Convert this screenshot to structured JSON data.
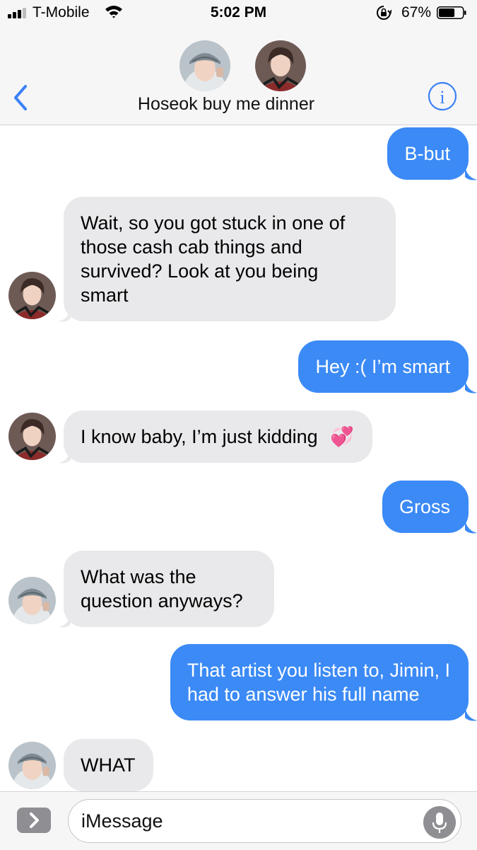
{
  "status_bar": {
    "carrier": "T-Mobile",
    "time": "5:02 PM",
    "battery_percent": "67%",
    "battery_level": 0.67
  },
  "header": {
    "title": "Hoseok buy me dinner",
    "back_icon": "chevron-left-icon",
    "info_icon": "info-icon",
    "accent": "#3b82f6"
  },
  "messages": [
    {
      "direction": "sent",
      "lines": [
        "B-but"
      ]
    },
    {
      "direction": "received",
      "sender": "tae",
      "lines": [
        "Wait, so you got stuck in one of",
        "those cash cab things and",
        "survived? Look at you being",
        "smart"
      ]
    },
    {
      "direction": "sent",
      "lines": [
        "Hey :( I’m smart"
      ]
    },
    {
      "direction": "received",
      "sender": "tae",
      "lines": [
        "I know baby, I’m just kidding"
      ],
      "emoji": "💞"
    },
    {
      "direction": "sent",
      "lines": [
        "Gross"
      ]
    },
    {
      "direction": "received",
      "sender": "hoseok",
      "lines": [
        "What was the",
        "question anyways?"
      ]
    },
    {
      "direction": "sent",
      "lines": [
        "That artist you listen to, Jimin, I",
        "had to answer his full name"
      ]
    },
    {
      "direction": "received",
      "sender": "hoseok",
      "lines": [
        "WHAT"
      ]
    }
  ],
  "input": {
    "placeholder": "iMessage",
    "apps_icon": "chevron-right-icon",
    "mic_icon": "microphone-icon"
  },
  "colors": {
    "sent_bubble": "#3b8af6",
    "received_bubble": "#e9e9eb",
    "bar_background": "#f6f6f7"
  }
}
